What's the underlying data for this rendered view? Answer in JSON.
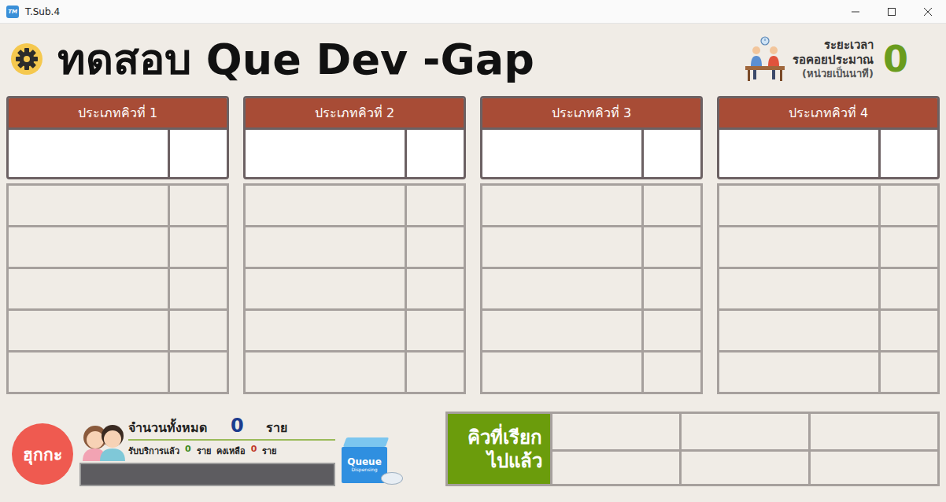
{
  "window": {
    "title": "T.Sub.4",
    "icon_text": "TM"
  },
  "header": {
    "title": "ทดสอบ Que Dev -Gap",
    "wait": {
      "lines": [
        "ระยะเวลา",
        "รอคอยประมาณ",
        "(หน่วยเป็นนาที)"
      ],
      "value": "0"
    }
  },
  "queue_types": [
    {
      "title": "ประเภทคิวที่ 1",
      "current": {
        "queue": "",
        "counter": ""
      },
      "rows": [
        {
          "queue": "",
          "counter": ""
        },
        {
          "queue": "",
          "counter": ""
        },
        {
          "queue": "",
          "counter": ""
        },
        {
          "queue": "",
          "counter": ""
        },
        {
          "queue": "",
          "counter": ""
        }
      ]
    },
    {
      "title": "ประเภทคิวที่ 2",
      "current": {
        "queue": "",
        "counter": ""
      },
      "rows": [
        {
          "queue": "",
          "counter": ""
        },
        {
          "queue": "",
          "counter": ""
        },
        {
          "queue": "",
          "counter": ""
        },
        {
          "queue": "",
          "counter": ""
        },
        {
          "queue": "",
          "counter": ""
        }
      ]
    },
    {
      "title": "ประเภทคิวที่ 3",
      "current": {
        "queue": "",
        "counter": ""
      },
      "rows": [
        {
          "queue": "",
          "counter": ""
        },
        {
          "queue": "",
          "counter": ""
        },
        {
          "queue": "",
          "counter": ""
        },
        {
          "queue": "",
          "counter": ""
        },
        {
          "queue": "",
          "counter": ""
        }
      ]
    },
    {
      "title": "ประเภทคิวที่ 4",
      "current": {
        "queue": "",
        "counter": ""
      },
      "rows": [
        {
          "queue": "",
          "counter": ""
        },
        {
          "queue": "",
          "counter": ""
        },
        {
          "queue": "",
          "counter": ""
        },
        {
          "queue": "",
          "counter": ""
        },
        {
          "queue": "",
          "counter": ""
        }
      ]
    }
  ],
  "summary": {
    "total_label": "จำนวนทั้งหมด",
    "total": "0",
    "total_unit": "ราย",
    "served_label": "รับบริการแล้ว",
    "served": "0",
    "served_unit": "ราย",
    "remaining_label": "คงเหลือ",
    "remaining": "0",
    "remaining_unit": "ราย",
    "level": 0
  },
  "logo": {
    "text": "ฮุกกะ"
  },
  "dispenser": {
    "lines": [
      "Queue",
      "Dispensing"
    ]
  },
  "called": {
    "label_lines": [
      "คิวที่เรียก",
      "ไปแล้ว"
    ],
    "cells": [
      "",
      "",
      "",
      "",
      "",
      ""
    ]
  }
}
